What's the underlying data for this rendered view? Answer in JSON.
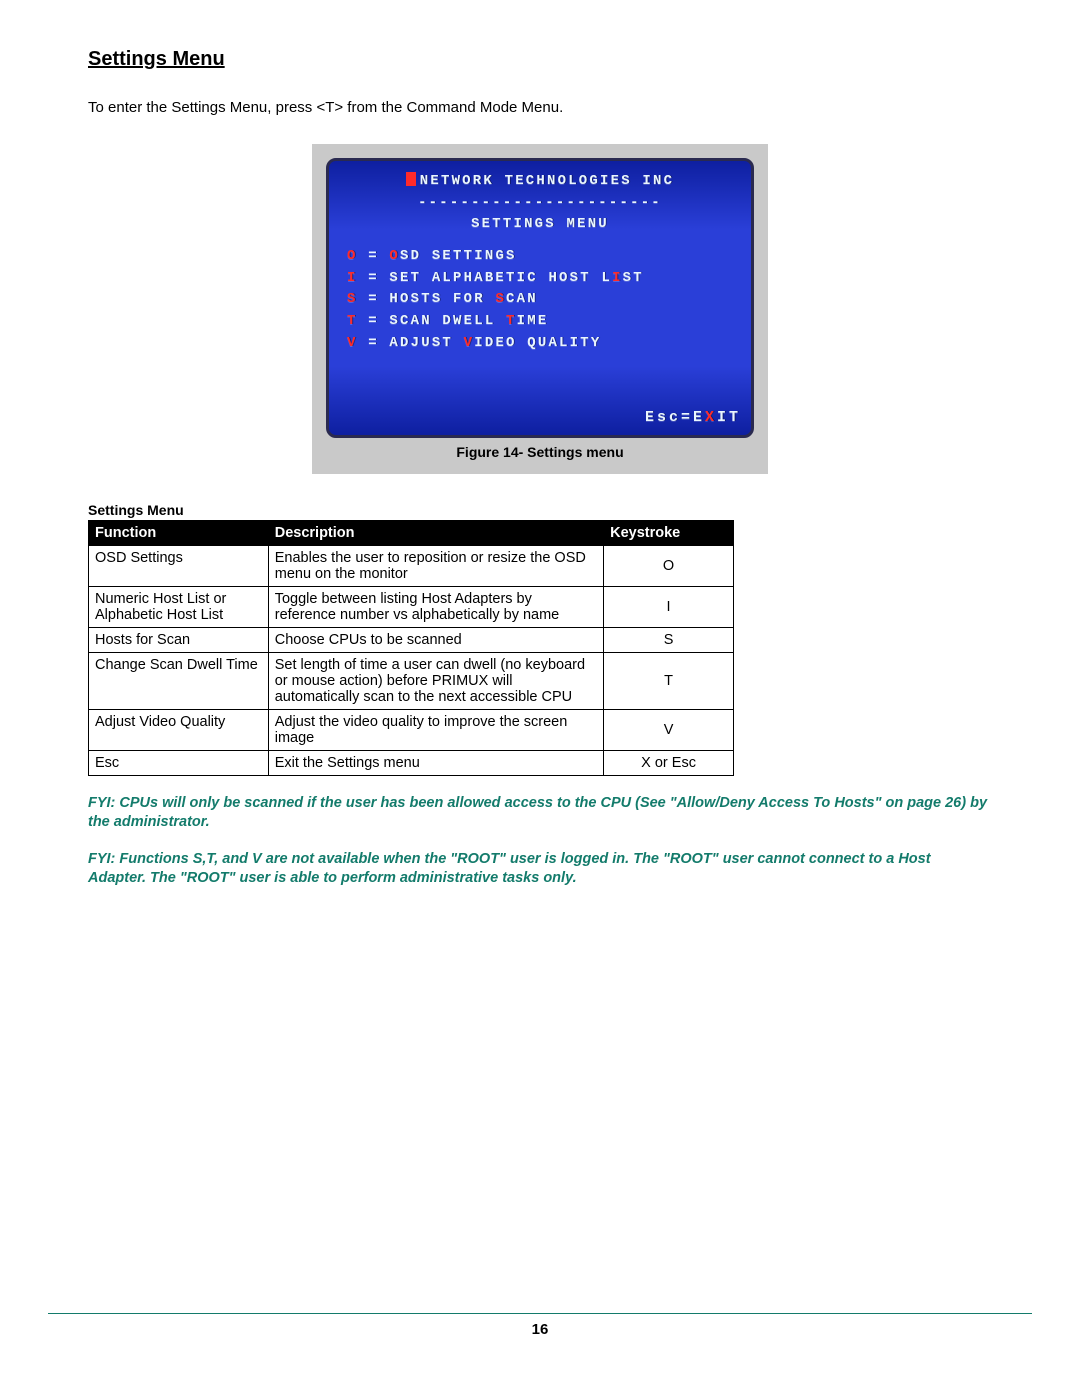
{
  "title": "Settings Menu",
  "intro": "To enter the Settings Menu, press <T> from the Command Mode Menu.",
  "crt": {
    "company": "NETWORK TECHNOLOGIES INC",
    "divider": "-----------------------",
    "heading": "SETTINGS MENU",
    "items": [
      {
        "key": "O",
        "pre": "",
        "hl": "O",
        "post": "SD SETTINGS"
      },
      {
        "key": "I",
        "pre": "SET ALPHABETIC HOST L",
        "hl": "I",
        "post": "ST"
      },
      {
        "key": "S",
        "pre": "HOSTS FOR ",
        "hl": "S",
        "post": "CAN"
      },
      {
        "key": "T",
        "pre": "SCAN DWELL ",
        "hl": "T",
        "post": "IME"
      },
      {
        "key": "V",
        "pre": "ADJUST ",
        "hl": "V",
        "post": "IDEO QUALITY"
      }
    ],
    "footer_pre": "Esc=E",
    "footer_hl": "X",
    "footer_post": "IT"
  },
  "figure_caption": "Figure 14- Settings menu",
  "table_title": "Settings Menu",
  "table": {
    "headers": [
      "Function",
      "Description",
      "Keystroke"
    ],
    "rows": [
      {
        "fn": "OSD Settings",
        "desc": "Enables the user to reposition or resize the OSD menu on the monitor",
        "key": "O"
      },
      {
        "fn": "Numeric Host List    or Alphabetic Host List",
        "desc": "Toggle between listing Host Adapters by reference number vs alphabetically by name",
        "key": "I"
      },
      {
        "fn": "Hosts for Scan",
        "desc": "Choose CPUs to be scanned",
        "key": "S"
      },
      {
        "fn": "Change Scan Dwell Time",
        "desc": "Set length of time a user can dwell (no keyboard or mouse action) before PRIMUX will automatically scan to the next accessible CPU",
        "key": "T"
      },
      {
        "fn": "Adjust Video Quality",
        "desc": "Adjust the video quality to improve the screen image",
        "key": "V"
      },
      {
        "fn": "Esc",
        "desc": "Exit the Settings menu",
        "key": "X or Esc"
      }
    ]
  },
  "fyi1": "FYI:  CPUs will only be scanned if the user has been allowed access to the CPU (See \"Allow/Deny Access To Hosts\" on page 26) by the administrator.",
  "fyi2": "FYI: Functions S,T, and V are not available when the \"ROOT\" user is logged in.  The \"ROOT\" user cannot connect to a Host Adapter.   The \"ROOT\" user is able to perform administrative tasks only.",
  "page_number": "16"
}
